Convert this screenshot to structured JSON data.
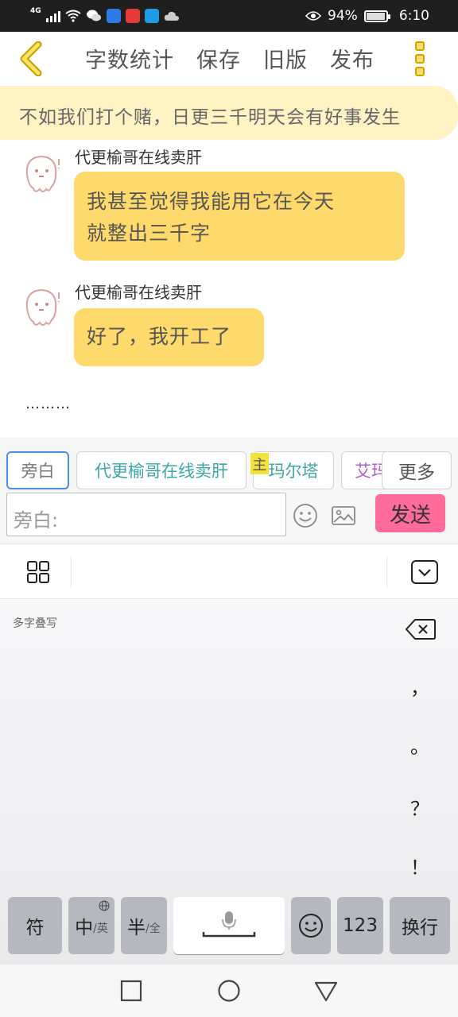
{
  "status_bar": {
    "network": "4G",
    "battery_percent": "94%",
    "battery_level": 0.94,
    "time": "6:10"
  },
  "nav": {
    "back_icon": "chevron-left-icon",
    "items": [
      "字数统计",
      "保存",
      "旧版",
      "发布"
    ],
    "more_icon": "kebab-menu-icon",
    "accent_color": "#fbe36a"
  },
  "banner": {
    "text": "不如我们打个赌，日更三千明天会有好事发生"
  },
  "chat": {
    "messages": [
      {
        "sender": "代更榆哥在线卖肝",
        "text_lines": [
          "我甚至觉得我能用它在今天",
          "就整出三千字"
        ]
      },
      {
        "sender": "代更榆哥在线卖肝",
        "text_lines": [
          "好了，我开工了"
        ]
      }
    ],
    "trailing_text": "………"
  },
  "roles": {
    "chips": [
      {
        "label": "旁白",
        "color": "#777777"
      },
      {
        "label": "代更榆哥在线卖肝",
        "color": "#3aa6a6"
      },
      {
        "label": "玛尔塔",
        "color": "#3aa6a6"
      },
      {
        "label": "艾玛",
        "color": "#b05fcf"
      }
    ],
    "more_label": "更多",
    "main_badge": "主"
  },
  "composer": {
    "placeholder": "旁白:",
    "send_label": "发送",
    "send_color": "#ff6b9a"
  },
  "keyboard": {
    "mode_label": "多字叠写",
    "punctuation": [
      "，",
      "。",
      "？",
      "！"
    ],
    "keys": {
      "symbol": "符",
      "chinese": "中",
      "chinese_sub": "/英",
      "half": "半",
      "half_sub": "/全",
      "numbers": "123",
      "enter": "换行"
    }
  }
}
